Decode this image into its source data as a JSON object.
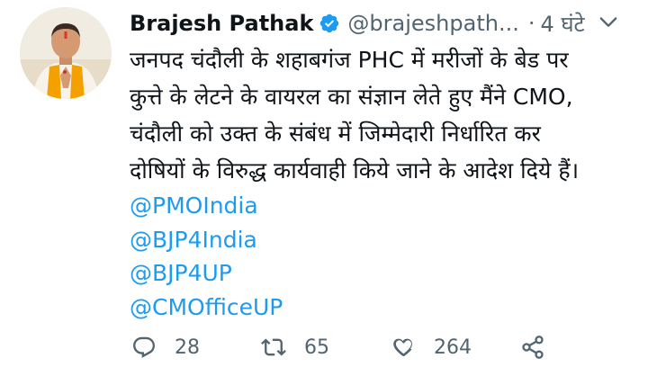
{
  "tweet": {
    "author": {
      "display_name": "Brajesh Pathak",
      "handle": "@brajeshpath...",
      "verified": true
    },
    "separator": "·",
    "time": "4 घंटे",
    "text_lines": [
      "जनपद चंदौली के शहाबगंज PHC में मरीजों के बेड पर",
      "कुत्ते के लेटने के वायरल का संज्ञान लेते हुए मैंने CMO,",
      "चंदौली को उक्त के संबंध में जिम्मेदारी निर्धारित कर",
      "दोषियों के विरुद्ध कार्यवाही किये जाने के आदेश दिये हैं।"
    ],
    "mentions": [
      "@PMOIndia",
      "@BJP4India",
      "@BJP4UP",
      "@CMOfficeUP"
    ],
    "stats": {
      "replies": "28",
      "retweets": "65",
      "likes": "264"
    },
    "icons": {
      "verified": "verified-badge-icon",
      "more": "more-chevron-icon",
      "reply": "reply-icon",
      "retweet": "retweet-icon",
      "like": "heart-icon",
      "share": "share-icon"
    },
    "colors": {
      "link": "#1d9bf0",
      "muted": "#536471",
      "text": "#0f1419",
      "saffron_scarf": "#f4a100"
    }
  }
}
